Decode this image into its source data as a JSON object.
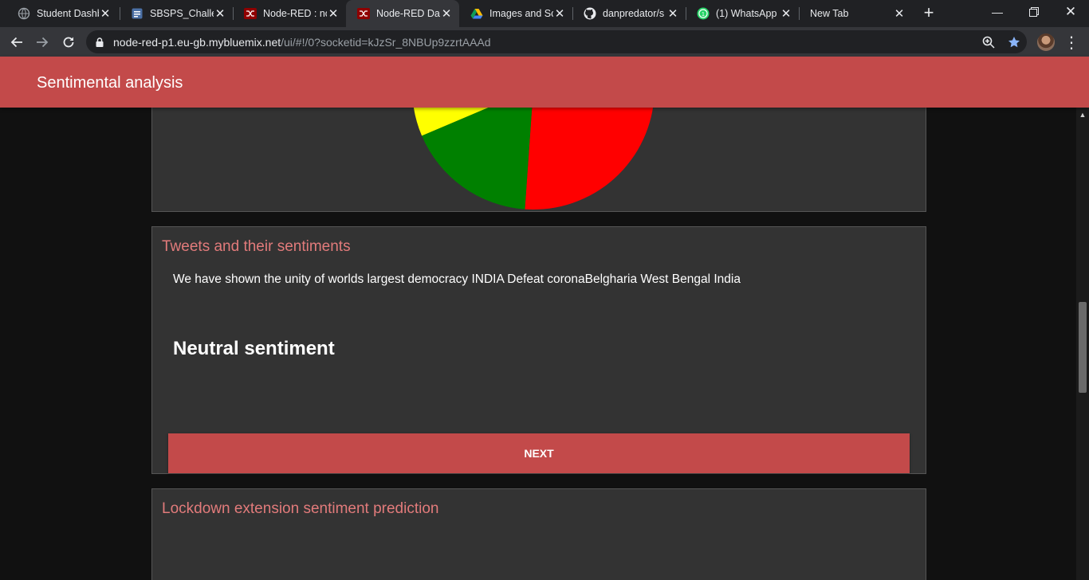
{
  "browser": {
    "tabs": [
      {
        "title": "Student Dashb",
        "icon": "globe-icon",
        "active": false
      },
      {
        "title": "SBSPS_Challen",
        "icon": "doc-icon",
        "active": false
      },
      {
        "title": "Node-RED : nc",
        "icon": "nodered-icon",
        "active": false
      },
      {
        "title": "Node-RED Das",
        "icon": "nodered-icon",
        "active": true
      },
      {
        "title": "Images and Sc",
        "icon": "drive-icon",
        "active": false
      },
      {
        "title": "danpredator/s",
        "icon": "github-icon",
        "active": false
      },
      {
        "title": "(1) WhatsApp",
        "icon": "whatsapp-icon",
        "active": false
      },
      {
        "title": "New Tab",
        "icon": "",
        "active": false
      }
    ],
    "url_host": "node-red-p1.eu-gb.mybluemix.net",
    "url_path": "/ui/#!/0?socketid=kJzSr_8NBUp9zzrtAAAd"
  },
  "dashboard": {
    "title": "Sentimental analysis",
    "accent_color": "#c34a4a"
  },
  "pie_card": {
    "chart_data": {
      "type": "pie",
      "slices": [
        {
          "color": "#ff0000"
        },
        {
          "color": "#008000"
        },
        {
          "color": "#ffff00"
        }
      ]
    }
  },
  "tweets_card": {
    "title": "Tweets and their sentiments",
    "tweet": "We have shown the unity of worlds largest democracy INDIA Defeat coronaBelgharia West Bengal India",
    "sentiment": "Neutral sentiment",
    "next_label": "NEXT"
  },
  "lockdown_card": {
    "title": "Lockdown extension sentiment prediction"
  }
}
